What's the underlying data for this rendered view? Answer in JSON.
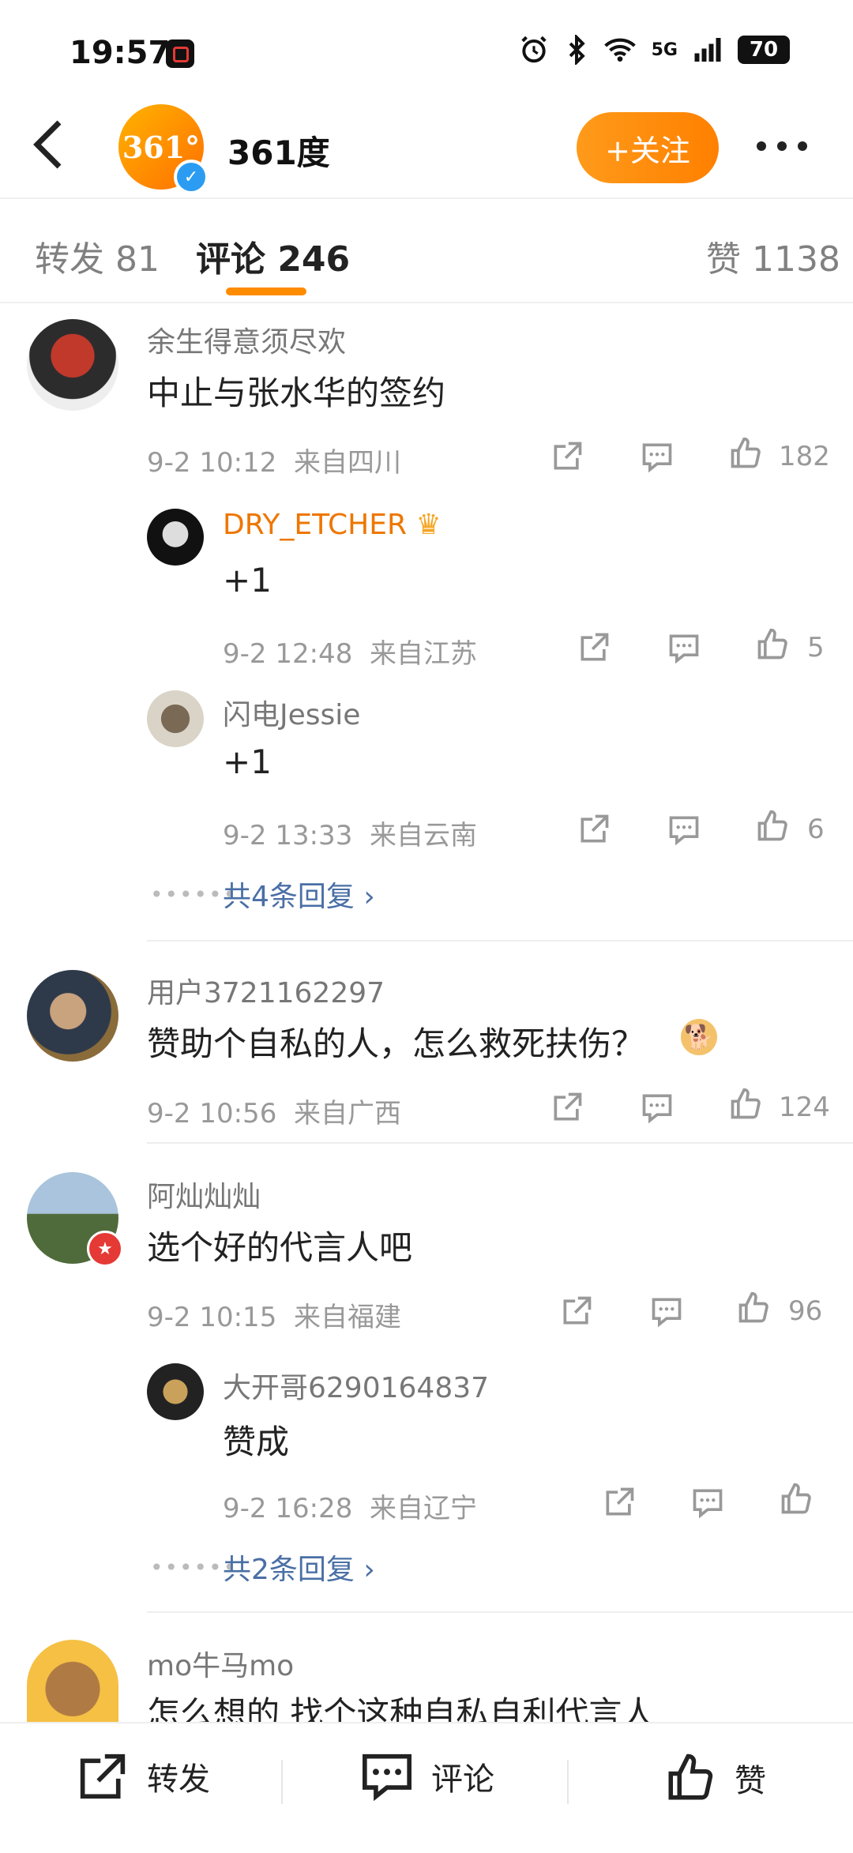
{
  "status_bar": {
    "time": "19:57",
    "battery": "70",
    "network": "5G"
  },
  "header": {
    "brand_logo_text": "361°",
    "title": "361度",
    "follow_label": "+关注"
  },
  "tabs": [
    {
      "label": "转发 81"
    },
    {
      "label": "评论 246"
    },
    {
      "label": "赞 1138"
    }
  ],
  "comments": [
    {
      "user": "余生得意须尽欢",
      "text": "中止与张水华的签约",
      "time": "9-2 10:12",
      "location": "来自四川",
      "likes": "182",
      "replies": [
        {
          "user": "DRY_ETCHER",
          "text": "+1",
          "time": "9-2 12:48",
          "location": "来自江苏",
          "likes": "5"
        },
        {
          "user": "闪电Jessie",
          "text": "+1",
          "time": "9-2 13:33",
          "location": "来自云南",
          "likes": "6"
        }
      ],
      "more_replies": "共4条回复 ›"
    },
    {
      "user": "用户3721162297",
      "text": "赞助个自私的人，怎么救死扶伤？",
      "time": "9-2 10:56",
      "location": "来自广西",
      "likes": "124"
    },
    {
      "user": "阿灿灿灿",
      "text": "选个好的代言人吧",
      "time": "9-2 10:15",
      "location": "来自福建",
      "likes": "96",
      "replies": [
        {
          "user": "大开哥6290164837",
          "text": "赞成",
          "time": "9-2 16:28",
          "location": "来自辽宁",
          "likes": ""
        }
      ],
      "more_replies": "共2条回复 ›"
    },
    {
      "user": "mo牛马mo",
      "text": "怎么想的 找个这种自私自利代言人"
    }
  ],
  "bottom_bar": {
    "repost": "转发",
    "comment": "评论",
    "like": "赞"
  },
  "colors": {
    "accent": "#ff8c00",
    "link": "#4a6fa5",
    "vip_name": "#ee7600",
    "verified": "#2b9cf2"
  }
}
